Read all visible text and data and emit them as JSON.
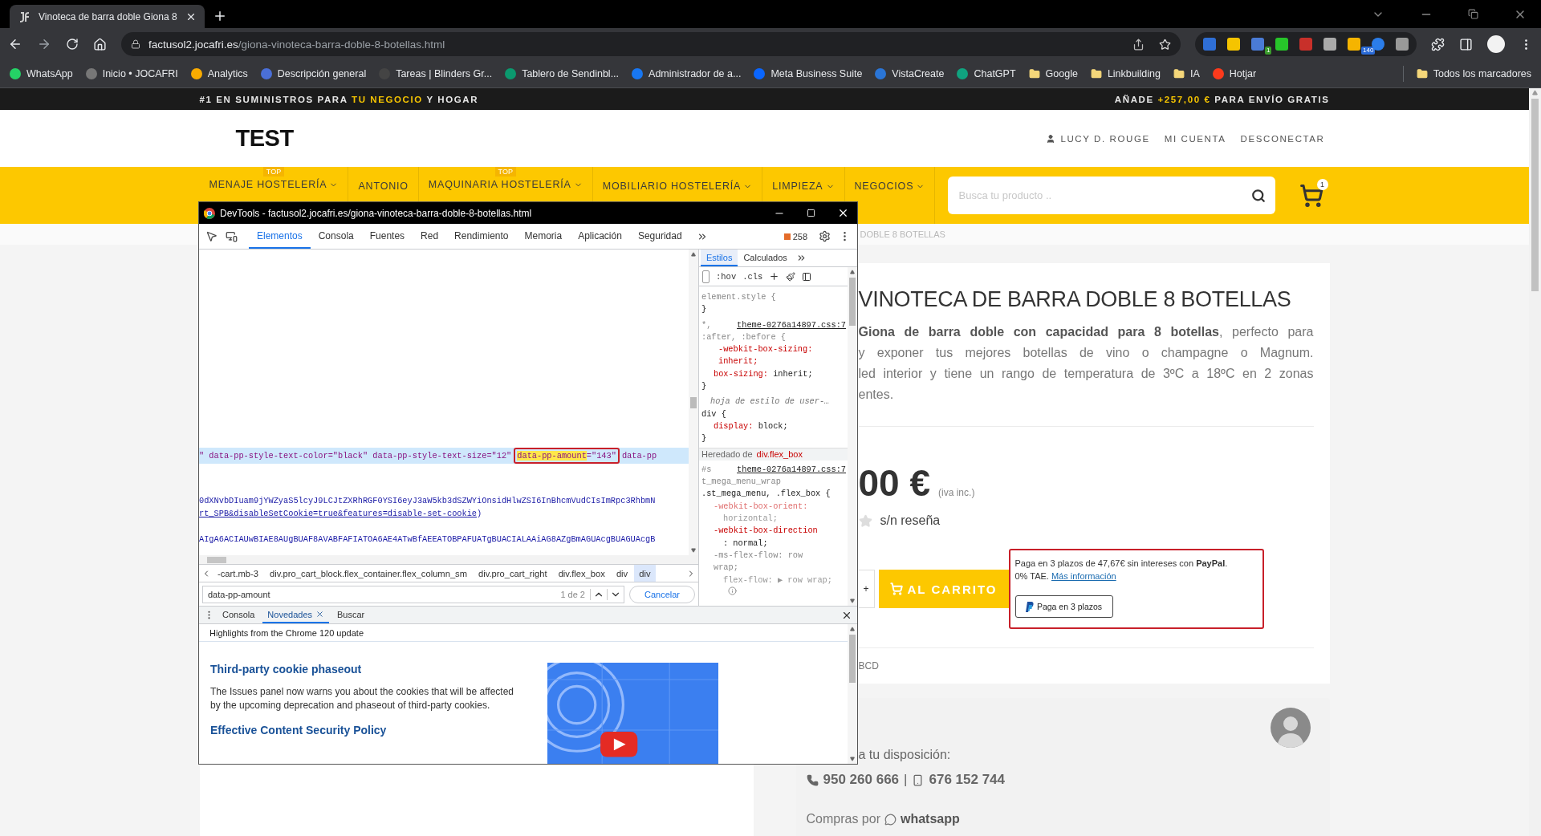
{
  "browser": {
    "tab": {
      "title": "Vinoteca de barra doble Giona 8"
    },
    "url": {
      "host": "factusol2.jocafri.es",
      "path": "/giona-vinoteca-barra-doble-8-botellas.html"
    },
    "extension_badges": [
      {
        "text": "1"
      },
      {
        "text": "140"
      }
    ],
    "bookmarks": [
      {
        "label": "WhatsApp",
        "kind": "site"
      },
      {
        "label": "Inicio • JOCAFRI",
        "kind": "site"
      },
      {
        "label": "Analytics",
        "kind": "site"
      },
      {
        "label": "Descripción general",
        "kind": "site"
      },
      {
        "label": "Tareas | Blinders Gr...",
        "kind": "site"
      },
      {
        "label": "Tablero de Sendinbl...",
        "kind": "site"
      },
      {
        "label": "Administrador de a...",
        "kind": "site"
      },
      {
        "label": "Meta Business Suite",
        "kind": "site"
      },
      {
        "label": "VistaCreate",
        "kind": "site"
      },
      {
        "label": "ChatGPT",
        "kind": "site"
      },
      {
        "label": "Google",
        "kind": "folder"
      },
      {
        "label": "Linkbuilding",
        "kind": "folder"
      },
      {
        "label": "IA",
        "kind": "folder"
      },
      {
        "label": "Hotjar",
        "kind": "site"
      }
    ],
    "all_bookmarks": "Todos los marcadores"
  },
  "promo_bar": {
    "left": [
      {
        "text": "#1 EN SUMINISTROS PARA ",
        "highlight": false
      },
      {
        "text": "TU NEGOCIO",
        "highlight": true
      },
      {
        "text": " Y HOGAR",
        "highlight": false
      }
    ],
    "right": [
      {
        "text": "AÑADE ",
        "highlight": false
      },
      {
        "text": "+257,00 €",
        "highlight": true
      },
      {
        "text": " PARA ENVÍO GRATIS",
        "highlight": false
      }
    ]
  },
  "header": {
    "logo": "TEST",
    "user": "LUCY D. ROUGE",
    "links": [
      "MI CUENTA",
      "DESCONECTAR"
    ]
  },
  "nav": {
    "items": [
      {
        "label": "MENAJE HOSTELERÍA",
        "badge": "TOP",
        "dropdown": true
      },
      {
        "label": "ANTONIO",
        "dropdown": false
      },
      {
        "label": "MAQUINARIA HOSTELERÍA",
        "badge": "TOP",
        "dropdown": true
      },
      {
        "label": "MOBILIARIO HOSTELERÍA",
        "dropdown": true
      },
      {
        "label": "LIMPIEZA",
        "dropdown": true
      },
      {
        "label": "NEGOCIOS",
        "dropdown": true
      }
    ],
    "search_placeholder": "Busca tu producto ..",
    "cart_count": "1"
  },
  "breadcrumb": "DOBLE 8 BOTELLAS",
  "product": {
    "title": "VINOTECA DE BARRA DOBLE 8 BOTELLAS",
    "description_lines": [
      "**Giona de barra doble con capacidad para 8 botellas**, perfecto para",
      "y exponer tus mejores botellas de vino o champagne o Magnum.",
      "led interior y tiene un rango de temperatura de 3ºC a 18ºC en 2 zonas",
      "entes."
    ],
    "price": "00 €",
    "tax_note": "(iva inc.)",
    "reviews": "s/n reseña",
    "quantity_button": "+",
    "add_to_cart": "AL CARRITO",
    "paypal": {
      "message": "Paga en 3 plazos de 47,67€ sin intereses con **PayPal**.",
      "terms": "0% TAE.",
      "link": "Más información",
      "button": "Paga en 3 plazos"
    },
    "sku": "BCD",
    "contact": {
      "intro": "a tu disposición:",
      "phone": "950 260 666",
      "separator": "|",
      "mobile": "676 152 744",
      "whatsapp_prefix": "Compras por",
      "whatsapp": "whatsapp"
    }
  },
  "devtools": {
    "title": "DevTools - factusol2.jocafri.es/giona-vinoteca-barra-doble-8-botellas.html",
    "tabs": [
      {
        "label": "Elementos",
        "selected": true
      },
      {
        "label": "Consola",
        "selected": false
      },
      {
        "label": "Fuentes",
        "selected": false
      },
      {
        "label": "Red",
        "selected": false
      },
      {
        "label": "Rendimiento",
        "selected": false
      },
      {
        "label": "Memoria",
        "selected": false
      },
      {
        "label": "Aplicación",
        "selected": false
      },
      {
        "label": "Seguridad",
        "selected": false
      }
    ],
    "issues_count": "258",
    "code_lines": [
      {
        "kind": "match",
        "before": "\" data-pp-style-text-color=\"black\" data-pp-style-text-size=\"12\"",
        "match": "data-pp-amount",
        "match_rest": "=\"143\"",
        "after": "data-pp"
      },
      {
        "kind": "text",
        "text": "0dXNvbDIuam9jYWZyaS5lcyJ9LCJtZXRhRGF0YSI6eyJ3aW5kb3dSZWYiOnsidHlwZSI6InBhcmVudCIsImRpc3RhbmN"
      },
      {
        "kind": "link",
        "text": "rt_SPB&disableSetCookie=true&features=disable-set-cookie",
        "suffix": ")"
      },
      {
        "kind": "text",
        "text": "AIgA6ACIAUwBIAE8AUgBUAF8AVABFAFIATOA6AE4ATwBfAEEATOBPAFUATgBUACIALAAiAG8AZgBmAGUAcgBUAGUAcgB"
      }
    ],
    "breadcrumbs": [
      {
        "label": "-cart.mb-3",
        "selected": false
      },
      {
        "label": "div.pro_cart_block.flex_container.flex_column_sm",
        "selected": false
      },
      {
        "label": "div.pro_cart_right",
        "selected": false
      },
      {
        "label": "div.flex_box",
        "selected": false
      },
      {
        "label": "div",
        "selected": false
      },
      {
        "label": "div",
        "selected": true
      }
    ],
    "search": {
      "value": "data-pp-amount",
      "count": "1 de 2",
      "cancel": "Cancelar"
    },
    "styles": {
      "tabs": [
        {
          "label": "Estilos",
          "selected": true
        },
        {
          "label": "Calculados",
          "selected": false
        }
      ],
      "hov": ":hov",
      "cls": ".cls",
      "lines": [
        {
          "kind": "muted",
          "text": "element.style {"
        },
        {
          "kind": "code",
          "text": "}"
        },
        {
          "kind": "origin",
          "text": "*,",
          "link": "theme-0276a14897.css:7"
        },
        {
          "kind": "muted",
          "text": ":after, :before {"
        },
        {
          "kind": "strike",
          "text": "-webkit-box-sizing:"
        },
        {
          "kind": "strike",
          "text": "inherit;"
        },
        {
          "kind": "prop",
          "name": "box-sizing:",
          "value": "inherit;"
        },
        {
          "kind": "code",
          "text": "}"
        },
        {
          "kind": "comment",
          "text": "hoja de estilo de user-…"
        },
        {
          "kind": "code",
          "text": "div {"
        },
        {
          "kind": "prop",
          "name": "display:",
          "value": "block;"
        },
        {
          "kind": "code",
          "text": "}"
        },
        {
          "kind": "section",
          "text": "Heredado de",
          "link": "div.flex_box"
        },
        {
          "kind": "origin",
          "text": "#s",
          "link": "theme-0276a14897.css:7"
        },
        {
          "kind": "muted",
          "text": "t_mega_menu_wrap"
        },
        {
          "kind": "code",
          "text": ".st_mega_menu, .flex_box {"
        },
        {
          "kind": "dimname",
          "text": "-webkit-box-orient:"
        },
        {
          "kind": "dimvalue",
          "text": "horizontal;"
        },
        {
          "kind": "name",
          "text": "-webkit-box-direction"
        },
        {
          "kind": "value",
          "text": ": normal;"
        },
        {
          "kind": "faded",
          "text": "-ms-flex-flow: row"
        },
        {
          "kind": "faded",
          "text": "wrap;"
        },
        {
          "kind": "dimvalue",
          "text": "flex-flow: ▶ row wrap;"
        },
        {
          "kind": "info"
        }
      ]
    },
    "drawer": {
      "tabs": [
        {
          "label": "Consola",
          "selected": false,
          "closable": false
        },
        {
          "label": "Novedades",
          "selected": true,
          "closable": true
        },
        {
          "label": "Buscar",
          "selected": false,
          "closable": false
        }
      ],
      "header": "Highlights from the Chrome 120 update",
      "items": [
        {
          "kind": "heading",
          "text": "Third-party cookie phaseout"
        },
        {
          "kind": "paragraph",
          "text": "The Issues panel now warns you about the cookies that will be affected by the upcoming deprecation and phaseout of third-party cookies."
        },
        {
          "kind": "heading",
          "text": "Effective Content Security Policy"
        }
      ]
    }
  }
}
